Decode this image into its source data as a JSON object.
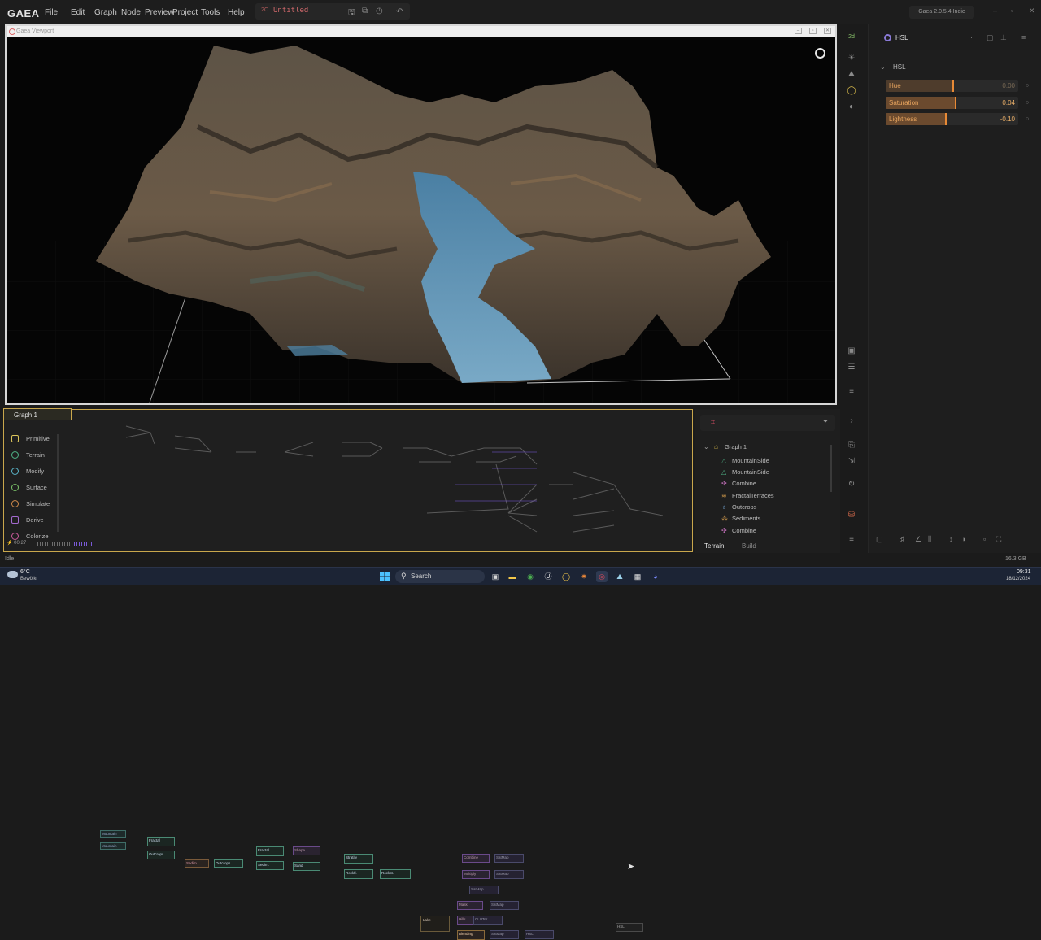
{
  "app": {
    "logo": "GAEA",
    "menu": [
      "File",
      "Edit",
      "Graph",
      "Node",
      "Preview",
      "Project",
      "Tools",
      "Help"
    ],
    "doc_badge": "2C",
    "doc_title": "Untitled",
    "version": "Gaea 2.0.5.4 Indie"
  },
  "viewport": {
    "title": "Gaea Viewport"
  },
  "properties": {
    "node_title": "HSL",
    "section": "HSL",
    "params": [
      {
        "label": "Hue",
        "value": "0.00",
        "fraction": 0.5,
        "dimmed": true
      },
      {
        "label": "Saturation",
        "value": "0.04",
        "fraction": 0.52,
        "dimmed": false
      },
      {
        "label": "Lightness",
        "value": "-0.10",
        "fraction": 0.45,
        "dimmed": false
      }
    ]
  },
  "graph": {
    "tab_label": "Graph 1",
    "palette": [
      "Primitive",
      "Terrain",
      "Modify",
      "Surface",
      "Simulate",
      "Derive",
      "Colorize"
    ],
    "status_time": "00:27",
    "nodes": [
      "Mountain",
      "Mountain",
      "Fractal",
      "Outcrops",
      "Sedim.",
      "Outcrops",
      "Fractal",
      "Sedim.",
      "Shape",
      "Sand",
      "Stratify",
      "Rockfl.",
      "Rockst.",
      "Lake",
      "Combine",
      "SatMap",
      "Multiply",
      "SatMap",
      "Mask",
      "SatMap",
      "Hills",
      "SatMap",
      "CLUTer",
      "Blending",
      "SatMap",
      "HSL",
      "HSL"
    ]
  },
  "tree": {
    "root": "Graph 1",
    "items": [
      {
        "label": "MountainSide",
        "icon": "mountain-icon",
        "color": "#4fb487"
      },
      {
        "label": "MountainSide",
        "icon": "mountain-icon",
        "color": "#4fb487"
      },
      {
        "label": "Combine",
        "icon": "combine-icon",
        "color": "#b86ab0"
      },
      {
        "label": "FractalTerraces",
        "icon": "terrace-icon",
        "color": "#d19a4b"
      },
      {
        "label": "Outcrops",
        "icon": "outcrops-icon",
        "color": "#7db4e8"
      },
      {
        "label": "Sediments",
        "icon": "sediments-icon",
        "color": "#d19a4b"
      },
      {
        "label": "Combine",
        "icon": "combine-icon",
        "color": "#b86ab0"
      }
    ],
    "tabs": [
      "Terrain",
      "Build"
    ]
  },
  "status": {
    "text": "Idle",
    "memory": "16.3 GB"
  },
  "taskbar": {
    "temp": "6°C",
    "weather": "Bewölkt",
    "search": "Search",
    "time": "09:31",
    "date": "18/12/2024"
  },
  "colors": {
    "accent": "#c9a74c",
    "param_fill": "#6b4a2e",
    "param_mark": "#e88a36"
  }
}
